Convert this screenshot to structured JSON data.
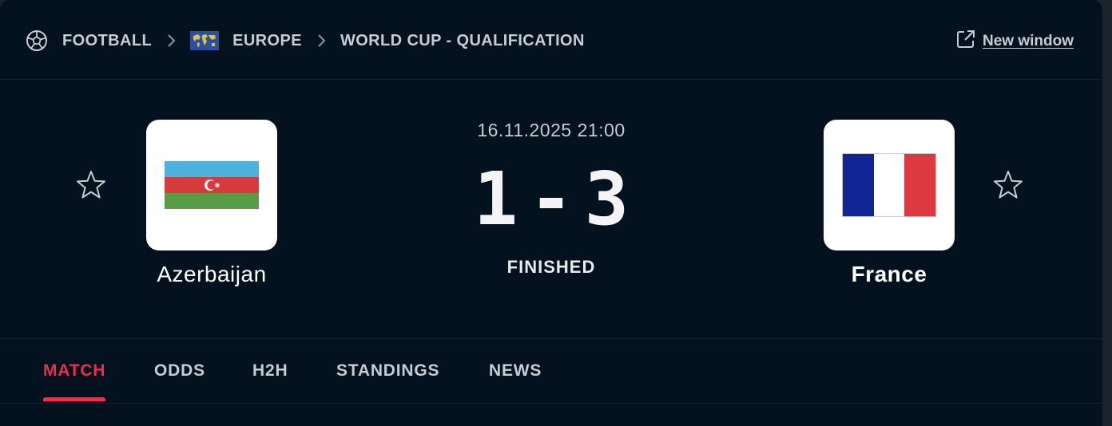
{
  "breadcrumb": {
    "sport": "FOOTBALL",
    "sport_icon": "football-icon",
    "region": "EUROPE",
    "region_icon": "world-map-flag-icon",
    "competition": "WORLD CUP - QUALIFICATION",
    "separator_icon": "chevron-right-icon"
  },
  "new_window": {
    "label": "New window",
    "icon": "external-link-icon"
  },
  "match": {
    "datetime": "16.11.2025 21:00",
    "score_home": "1",
    "score_separator": "-",
    "score_away": "3",
    "status": "FINISHED",
    "home": {
      "name": "Azerbaijan",
      "flag_icon": "azerbaijan-flag-icon",
      "flag_colors": [
        "#4fb1de",
        "#d83a3d",
        "#5a9c45"
      ],
      "favorite_icon": "star-outline-icon"
    },
    "away": {
      "name": "France",
      "flag_icon": "france-flag-icon",
      "flag_colors": [
        "#102593",
        "#ffffff",
        "#dd3a3f"
      ],
      "favorite_icon": "star-outline-icon"
    }
  },
  "tabs": [
    {
      "label": "MATCH",
      "active": true
    },
    {
      "label": "ODDS",
      "active": false
    },
    {
      "label": "H2H",
      "active": false
    },
    {
      "label": "STANDINGS",
      "active": false
    },
    {
      "label": "NEWS",
      "active": false
    }
  ],
  "colors": {
    "background": "#03121e",
    "accent": "#e8304e",
    "text_muted": "#c8ccd0",
    "text_primary": "#ffffff"
  }
}
